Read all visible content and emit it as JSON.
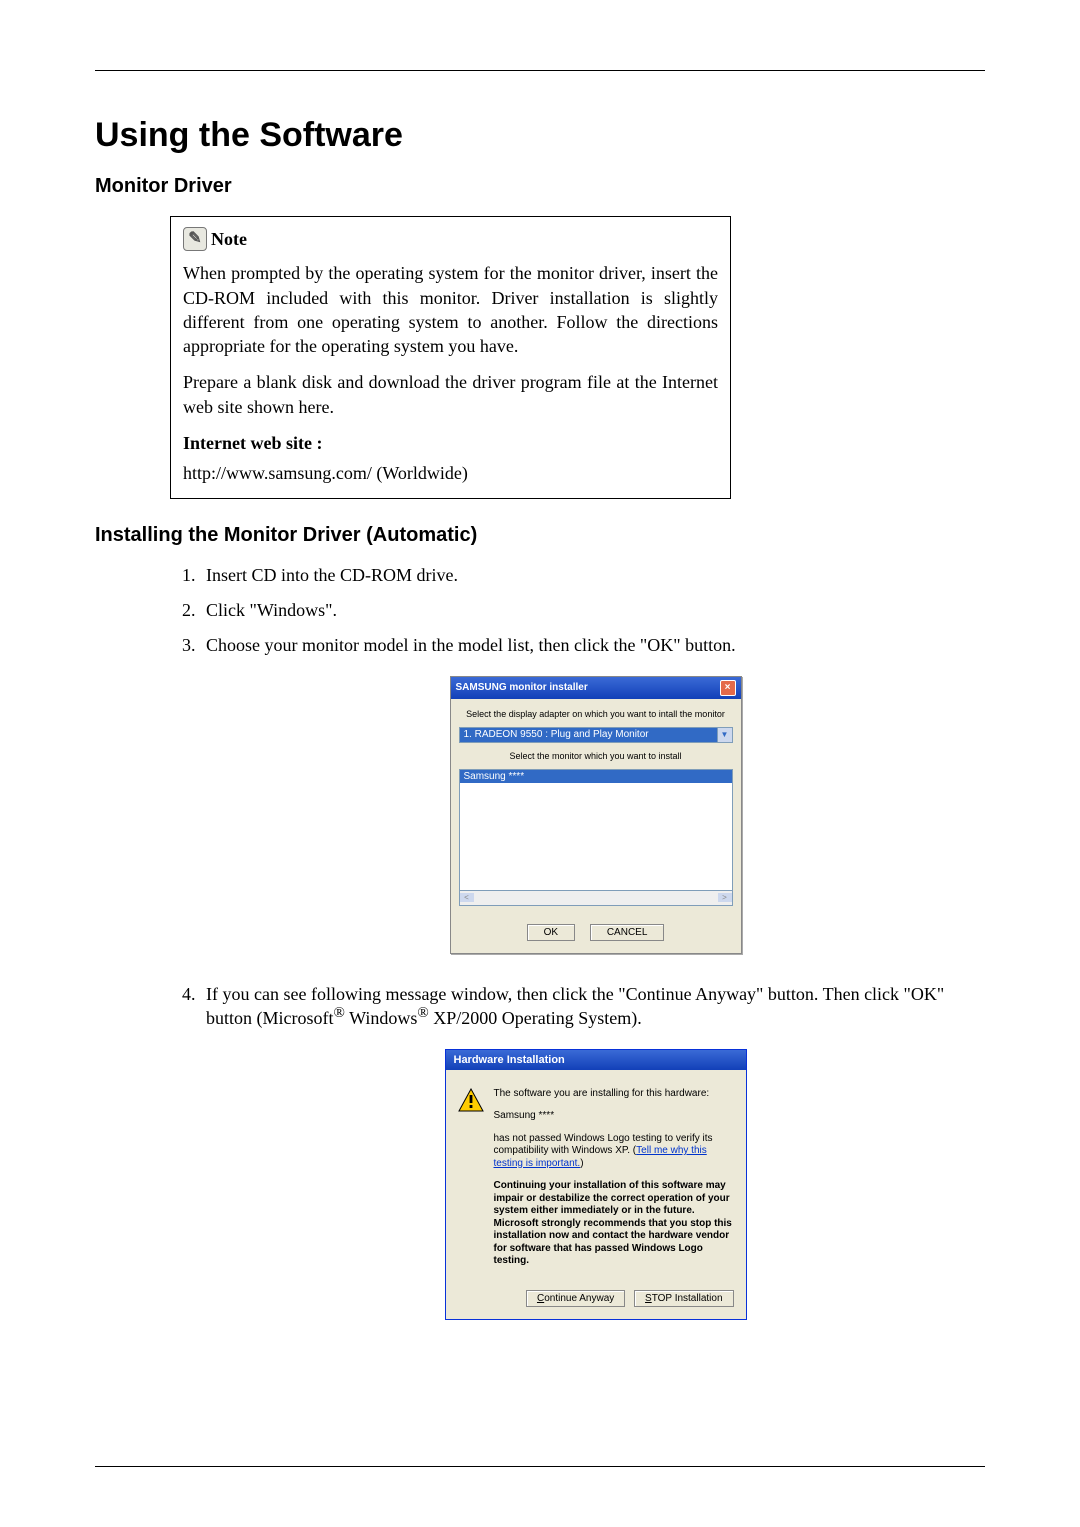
{
  "title": "Using the Software",
  "section1": "Monitor Driver",
  "note": {
    "label": "Note",
    "para1": "When prompted by the operating system for the monitor driver, insert the CD-ROM included with this monitor. Driver installation is slightly different from one operating system to another. Follow the directions appropriate for the operating system you have.",
    "para2": "Prepare a blank disk and download the driver program file at the Internet web site shown here.",
    "weblabel": "Internet web site :",
    "url": "http://www.samsung.com/ (Worldwide)"
  },
  "section2": "Installing the Monitor Driver (Automatic)",
  "steps": {
    "s1": "Insert CD into the CD-ROM drive.",
    "s2": "Click \"Windows\".",
    "s3": "Choose your monitor model in the model list, then click the \"OK\" button.",
    "s4a": "If you can see following message window, then click the \"Continue Anyway\" button. Then click \"OK\" button (Microsoft",
    "s4b": "Windows",
    "s4c": "XP/2000 Operating System)."
  },
  "dlg1": {
    "title": "SAMSUNG monitor installer",
    "instr1": "Select the display adapter on which you want to intall the monitor",
    "combo": "1. RADEON 9550 : Plug and Play Monitor",
    "instr2": "Select the monitor which you want to install",
    "listitem": "Samsung ****",
    "ok": "OK",
    "cancel": "CANCEL"
  },
  "dlg2": {
    "title": "Hardware Installation",
    "p1": "The software you are installing for this hardware:",
    "p2": "Samsung ****",
    "p3a": "has not passed Windows Logo testing to verify its compatibility with Windows XP. (",
    "p3link": "Tell me why this testing is important.",
    "p3b": ")",
    "p4": "Continuing your installation of this software may impair or destabilize the correct operation of your system either immediately or in the future. Microsoft strongly recommends that you stop this installation now and contact the hardware vendor for software that has passed Windows Logo testing.",
    "continue": "Continue Anyway",
    "stop": "STOP Installation"
  }
}
